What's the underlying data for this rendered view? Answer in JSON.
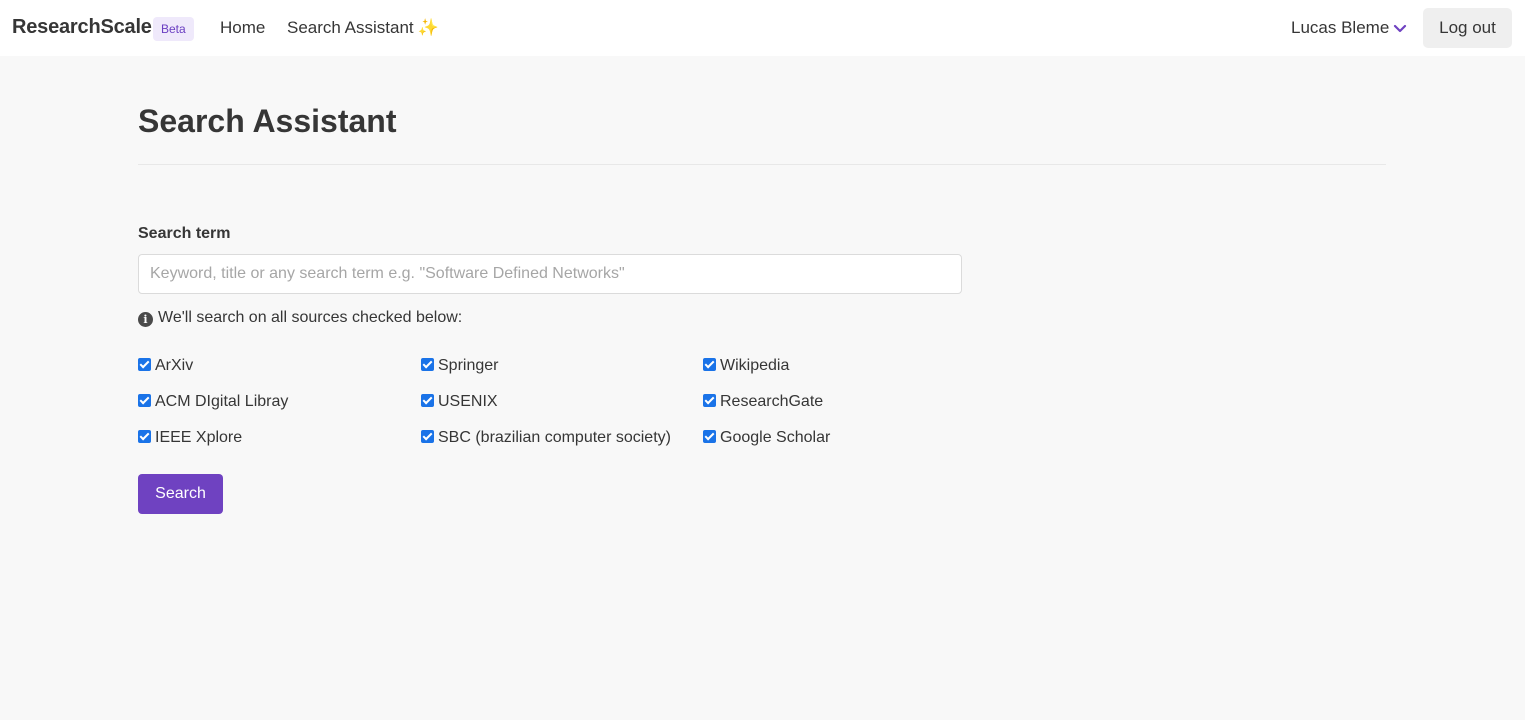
{
  "navbar": {
    "brand": "ResearchScale",
    "badge": "Beta",
    "links": [
      {
        "label": "Home"
      },
      {
        "label": "Search Assistant",
        "emoji": "✨"
      }
    ],
    "user_name": "Lucas Bleme",
    "logout_label": "Log out"
  },
  "main": {
    "title": "Search Assistant",
    "search_label": "Search term",
    "search_value": "",
    "search_placeholder": "Keyword, title or any search term e.g. \"Software Defined Networks\"",
    "info_text": "We'll search on all sources checked below:",
    "sources": [
      {
        "label": "ArXiv",
        "checked": true
      },
      {
        "label": "Springer",
        "checked": true
      },
      {
        "label": "Wikipedia",
        "checked": true
      },
      {
        "label": "ACM DIgital Libray",
        "checked": true
      },
      {
        "label": "USENIX",
        "checked": true
      },
      {
        "label": "ResearchGate",
        "checked": true
      },
      {
        "label": "IEEE Xplore",
        "checked": true
      },
      {
        "label": "SBC (brazilian computer society)",
        "checked": true
      },
      {
        "label": "Google Scholar",
        "checked": true
      }
    ],
    "search_button": "Search"
  },
  "colors": {
    "accent": "#6f42c1",
    "checkbox": "#1a73e8",
    "background": "#f8f8f8"
  }
}
